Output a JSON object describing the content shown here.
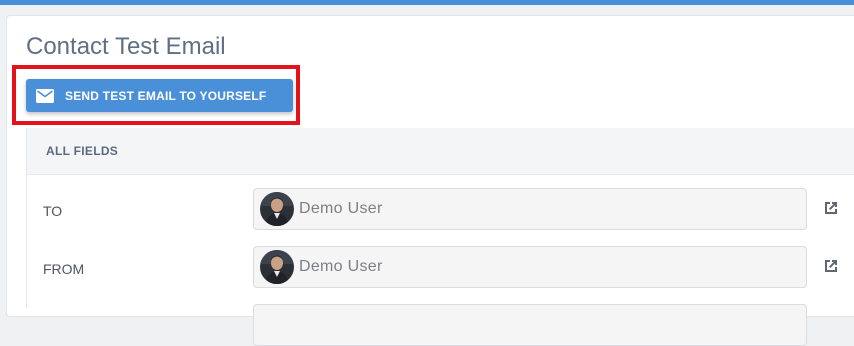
{
  "header": {
    "title": "Contact Test Email",
    "accent_color": "#4a90d9"
  },
  "actions": {
    "send_test_label": "SEND TEST EMAIL TO YOURSELF",
    "send_test_icon": "envelope-icon",
    "highlight_color": "#e3131b"
  },
  "fields_section": {
    "heading": "ALL FIELDS",
    "rows": [
      {
        "label": "TO",
        "value": "Demo User",
        "icon": "open-in-new-icon"
      },
      {
        "label": "FROM",
        "value": "Demo User",
        "icon": "open-in-new-icon"
      }
    ]
  }
}
